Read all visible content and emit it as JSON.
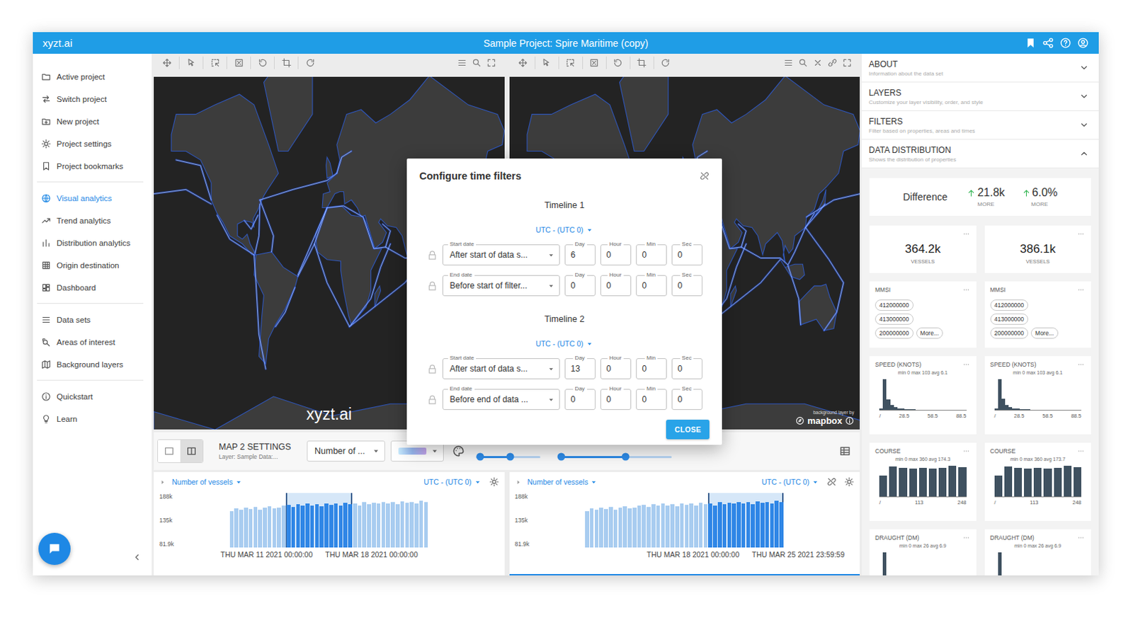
{
  "app": {
    "logo": "xyzt.ai",
    "title": "Sample Project: Spire Maritime (copy)"
  },
  "sidebar": {
    "groups": [
      [
        {
          "label": "Active project",
          "selected": false
        },
        {
          "label": "Switch project",
          "selected": false
        },
        {
          "label": "New project",
          "selected": false
        },
        {
          "label": "Project settings",
          "selected": false
        },
        {
          "label": "Project bookmarks",
          "selected": false
        }
      ],
      [
        {
          "label": "Visual analytics",
          "selected": true
        },
        {
          "label": "Trend analytics",
          "selected": false
        },
        {
          "label": "Distribution analytics",
          "selected": false
        },
        {
          "label": "Origin destination",
          "selected": false
        },
        {
          "label": "Dashboard",
          "selected": false
        }
      ],
      [
        {
          "label": "Data sets",
          "selected": false
        },
        {
          "label": "Areas of interest",
          "selected": false
        },
        {
          "label": "Background layers",
          "selected": false
        }
      ],
      [
        {
          "label": "Quickstart",
          "selected": false
        },
        {
          "label": "Learn",
          "selected": false
        }
      ]
    ]
  },
  "maps": [
    {
      "watermark": "xyzt.ai"
    },
    {
      "credit_caption": "background layer by",
      "credit": "mapbox"
    }
  ],
  "map_settings": {
    "layouts": [
      {
        "selected": false
      },
      {
        "selected": true
      }
    ],
    "title": "MAP 2 SETTINGS",
    "layer": "Layer: Sample Data:...",
    "metric": "Number of ...",
    "sliders": [
      {
        "low": 0.06,
        "high": 0.53
      },
      {
        "low": 0.0,
        "high": 0.58
      }
    ]
  },
  "timelines": [
    {
      "metric": "Number of vessels",
      "timezone": "UTC - (UTC 0)",
      "unlinked": false,
      "active": false,
      "y_ticks": [
        "188k",
        "135k",
        "81.9k"
      ],
      "axis": {
        "min": 81900,
        "max": 188000
      },
      "bars": [
        {
          "value": 152000,
          "selected": false
        },
        {
          "value": 158000,
          "selected": false
        },
        {
          "value": 155000,
          "selected": false
        },
        {
          "value": 160000,
          "selected": false
        },
        {
          "value": 157000,
          "selected": false
        },
        {
          "value": 161000,
          "selected": false
        },
        {
          "value": 156000,
          "selected": false
        },
        {
          "value": 159000,
          "selected": false
        },
        {
          "value": 162000,
          "selected": false
        },
        {
          "value": 158000,
          "selected": false
        },
        {
          "value": 160000,
          "selected": false
        },
        {
          "value": 163000,
          "selected": false
        },
        {
          "value": 165000,
          "selected": true
        },
        {
          "value": 161000,
          "selected": true
        },
        {
          "value": 166000,
          "selected": true
        },
        {
          "value": 163000,
          "selected": true
        },
        {
          "value": 167000,
          "selected": true
        },
        {
          "value": 164000,
          "selected": true
        },
        {
          "value": 166000,
          "selected": true
        },
        {
          "value": 162000,
          "selected": true
        },
        {
          "value": 168000,
          "selected": true
        },
        {
          "value": 165000,
          "selected": true
        },
        {
          "value": 167000,
          "selected": true
        },
        {
          "value": 163000,
          "selected": true
        },
        {
          "value": 169000,
          "selected": true
        },
        {
          "value": 166000,
          "selected": true
        },
        {
          "value": 168000,
          "selected": false
        },
        {
          "value": 164000,
          "selected": false
        },
        {
          "value": 170000,
          "selected": false
        },
        {
          "value": 166000,
          "selected": false
        },
        {
          "value": 169000,
          "selected": false
        },
        {
          "value": 167000,
          "selected": false
        },
        {
          "value": 171000,
          "selected": false
        },
        {
          "value": 168000,
          "selected": false
        },
        {
          "value": 170000,
          "selected": false
        },
        {
          "value": 166000,
          "selected": false
        },
        {
          "value": 172000,
          "selected": false
        },
        {
          "value": 169000,
          "selected": false
        },
        {
          "value": 171000,
          "selected": false
        },
        {
          "value": 168000,
          "selected": false
        },
        {
          "value": 173000,
          "selected": false
        },
        {
          "value": 170000,
          "selected": false
        }
      ],
      "range_labels": [
        "THU MAR 11 2021 00:00:00",
        "THU MAR 18 2021 00:00:00"
      ]
    },
    {
      "metric": "Number of vessels",
      "timezone": "UTC - (UTC 0)",
      "unlinked": true,
      "active": true,
      "y_ticks": [
        "188k",
        "135k",
        "81.9k"
      ],
      "axis": {
        "min": 81900,
        "max": 188000
      },
      "bars": [
        {
          "value": 152000,
          "selected": false
        },
        {
          "value": 158000,
          "selected": false
        },
        {
          "value": 155000,
          "selected": false
        },
        {
          "value": 160000,
          "selected": false
        },
        {
          "value": 157000,
          "selected": false
        },
        {
          "value": 161000,
          "selected": false
        },
        {
          "value": 156000,
          "selected": false
        },
        {
          "value": 159000,
          "selected": false
        },
        {
          "value": 162000,
          "selected": false
        },
        {
          "value": 158000,
          "selected": false
        },
        {
          "value": 160000,
          "selected": false
        },
        {
          "value": 163000,
          "selected": false
        },
        {
          "value": 165000,
          "selected": false
        },
        {
          "value": 161000,
          "selected": false
        },
        {
          "value": 166000,
          "selected": false
        },
        {
          "value": 163000,
          "selected": false
        },
        {
          "value": 167000,
          "selected": false
        },
        {
          "value": 164000,
          "selected": false
        },
        {
          "value": 166000,
          "selected": false
        },
        {
          "value": 162000,
          "selected": false
        },
        {
          "value": 168000,
          "selected": false
        },
        {
          "value": 165000,
          "selected": false
        },
        {
          "value": 167000,
          "selected": false
        },
        {
          "value": 163000,
          "selected": false
        },
        {
          "value": 169000,
          "selected": false
        },
        {
          "value": 166000,
          "selected": false
        },
        {
          "value": 168000,
          "selected": true
        },
        {
          "value": 164000,
          "selected": true
        },
        {
          "value": 170000,
          "selected": true
        },
        {
          "value": 166000,
          "selected": true
        },
        {
          "value": 169000,
          "selected": true
        },
        {
          "value": 167000,
          "selected": true
        },
        {
          "value": 171000,
          "selected": true
        },
        {
          "value": 168000,
          "selected": true
        },
        {
          "value": 170000,
          "selected": true
        },
        {
          "value": 166000,
          "selected": true
        },
        {
          "value": 172000,
          "selected": true
        },
        {
          "value": 169000,
          "selected": true
        },
        {
          "value": 171000,
          "selected": true
        },
        {
          "value": 168000,
          "selected": true
        },
        {
          "value": 173000,
          "selected": true
        },
        {
          "value": 170000,
          "selected": true
        }
      ],
      "range_labels": [
        "THU MAR 18 2021 00:00:00",
        "THU MAR 25 2021 23:59:59"
      ]
    }
  ],
  "dialog": {
    "title": "Configure time filters",
    "close": "CLOSE",
    "timelines": [
      {
        "title": "Timeline 1",
        "timezone": "UTC - (UTC 0)",
        "rows": [
          {
            "label": "Start date",
            "value": "After start of data s...",
            "fields": [
              {
                "label": "Day",
                "value": "6"
              },
              {
                "label": "Hour",
                "value": "0"
              },
              {
                "label": "Min",
                "value": "0"
              },
              {
                "label": "Sec",
                "value": "0"
              }
            ]
          },
          {
            "label": "End date",
            "value": "Before start of filter...",
            "fields": [
              {
                "label": "Day",
                "value": "0"
              },
              {
                "label": "Hour",
                "value": "0"
              },
              {
                "label": "Min",
                "value": "0"
              },
              {
                "label": "Sec",
                "value": "0"
              }
            ]
          }
        ]
      },
      {
        "title": "Timeline 2",
        "timezone": "UTC - (UTC 0)",
        "rows": [
          {
            "label": "Start date",
            "value": "After start of data s...",
            "fields": [
              {
                "label": "Day",
                "value": "13"
              },
              {
                "label": "Hour",
                "value": "0"
              },
              {
                "label": "Min",
                "value": "0"
              },
              {
                "label": "Sec",
                "value": "0"
              }
            ]
          },
          {
            "label": "End date",
            "value": "Before end of data ...",
            "fields": [
              {
                "label": "Day",
                "value": "0"
              },
              {
                "label": "Hour",
                "value": "0"
              },
              {
                "label": "Min",
                "value": "0"
              },
              {
                "label": "Sec",
                "value": "0"
              }
            ]
          }
        ]
      }
    ]
  },
  "panel": {
    "sections": [
      {
        "title": "ABOUT",
        "subtitle": "Information about the data set",
        "expanded": false
      },
      {
        "title": "LAYERS",
        "subtitle": "Customize your layer visibility, order, and style",
        "expanded": false
      },
      {
        "title": "FILTERS",
        "subtitle": "Filter based on properties, areas and times",
        "expanded": false
      },
      {
        "title": "DATA DISTRIBUTION",
        "subtitle": "Shows the distribution of properties",
        "expanded": true
      }
    ],
    "difference": {
      "label": "Difference",
      "items": [
        {
          "value": "21.8k",
          "caption": "MORE"
        },
        {
          "value": "6.0%",
          "caption": "MORE"
        }
      ]
    },
    "columns": [
      {
        "count": {
          "value": "364.2k",
          "caption": "VESSELS"
        },
        "mmsi": {
          "title": "MMSI",
          "tags": [
            "412000000",
            "413000000",
            "200000000"
          ],
          "more": "More..."
        },
        "speed": {
          "title": "SPEED (KNOTS)",
          "stats": "min 0 max 103 avg 6.1",
          "bins": [
            3,
            58,
            20,
            9,
            5,
            3,
            2,
            1,
            1,
            1,
            0,
            0,
            0,
            0,
            0,
            0,
            0,
            0,
            0,
            0,
            0,
            0,
            0,
            0
          ],
          "ticks": [
            "/",
            "28.5",
            "58.5",
            "88.5"
          ]
        },
        "course": {
          "title": "COURSE",
          "stats": "min 0 max 360 avg 174.3",
          "bins": [
            28,
            40,
            38,
            37,
            38,
            37,
            38,
            41,
            39
          ],
          "ticks": [
            "/",
            "113",
            "248"
          ]
        },
        "draught": {
          "title": "DRAUGHT (DM)",
          "stats": "min 0 max 26 avg 6.9",
          "bins": [
            2,
            55,
            12,
            4,
            2,
            1,
            0,
            0,
            0,
            0,
            0,
            0,
            0,
            0,
            0,
            0,
            0,
            0,
            0,
            0,
            0,
            0,
            0,
            0
          ]
        }
      },
      {
        "count": {
          "value": "386.1k",
          "caption": "VESSELS"
        },
        "mmsi": {
          "title": "MMSI",
          "tags": [
            "412000000",
            "413000000",
            "200000000"
          ],
          "more": "More..."
        },
        "speed": {
          "title": "SPEED (KNOTS)",
          "stats": "min 0 max 103 avg 6.1",
          "bins": [
            3,
            57,
            21,
            9,
            5,
            3,
            2,
            1,
            1,
            1,
            0,
            0,
            0,
            0,
            0,
            0,
            0,
            0,
            0,
            0,
            0,
            0,
            0,
            0
          ],
          "ticks": [
            "/",
            "28.5",
            "58.5",
            "88.5"
          ]
        },
        "course": {
          "title": "COURSE",
          "stats": "min 0 max 360 avg 173.7",
          "bins": [
            29,
            41,
            39,
            38,
            39,
            38,
            39,
            42,
            40
          ],
          "ticks": [
            "/",
            "113",
            "248"
          ]
        },
        "draught": {
          "title": "DRAUGHT (DM)",
          "stats": "min 0 max 26 avg 6.9",
          "bins": [
            2,
            56,
            12,
            4,
            2,
            1,
            0,
            0,
            0,
            0,
            0,
            0,
            0,
            0,
            0,
            0,
            0,
            0,
            0,
            0,
            0,
            0,
            0,
            0
          ]
        }
      }
    ]
  }
}
